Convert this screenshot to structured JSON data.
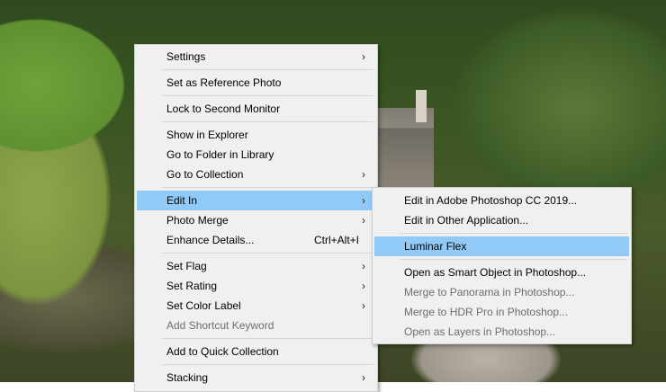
{
  "main_menu": {
    "items": [
      {
        "label": "Settings",
        "arrow": "›"
      },
      {
        "label": "Set as Reference Photo"
      },
      {
        "label": "Lock to Second Monitor"
      },
      {
        "label": "Show in Explorer"
      },
      {
        "label": "Go to Folder in Library"
      },
      {
        "label": "Go to Collection",
        "arrow": "›"
      },
      {
        "label": "Edit In",
        "arrow": "›"
      },
      {
        "label": "Photo Merge",
        "arrow": "›"
      },
      {
        "label": "Enhance Details...",
        "shortcut": "Ctrl+Alt+I"
      },
      {
        "label": "Set Flag",
        "arrow": "›"
      },
      {
        "label": "Set Rating",
        "arrow": "›"
      },
      {
        "label": "Set Color Label",
        "arrow": "›"
      },
      {
        "label": "Add Shortcut Keyword"
      },
      {
        "label": "Add to Quick Collection"
      },
      {
        "label": "Stacking",
        "arrow": "›"
      }
    ]
  },
  "sub_menu": {
    "items": [
      {
        "label": "Edit in Adobe Photoshop CC 2019..."
      },
      {
        "label": "Edit in Other Application..."
      },
      {
        "label": "Luminar Flex"
      },
      {
        "label": "Open as Smart Object in Photoshop..."
      },
      {
        "label": "Merge to Panorama in Photoshop..."
      },
      {
        "label": "Merge to HDR Pro in Photoshop..."
      },
      {
        "label": "Open as Layers in Photoshop..."
      }
    ]
  },
  "colors": {
    "menu_bg": "#f0f0f0",
    "highlight": "#91c9f7",
    "disabled_text": "#6d6d6d"
  }
}
